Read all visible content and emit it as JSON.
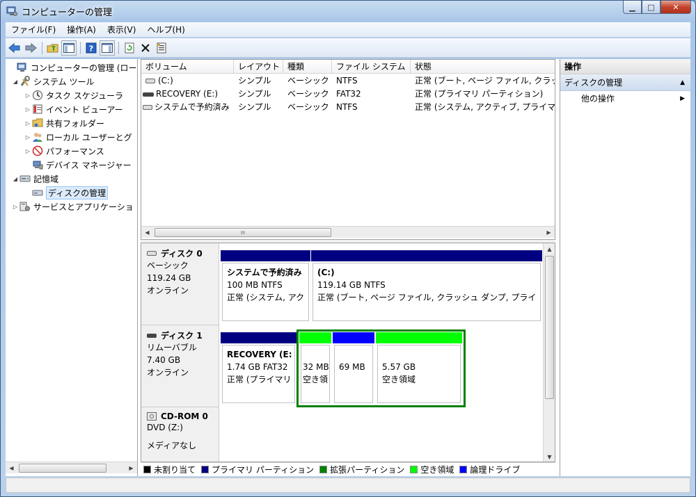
{
  "window": {
    "title": "コンピューターの管理",
    "controls": [
      "minimize",
      "maximize",
      "close"
    ]
  },
  "menubar": {
    "items": [
      "ファイル(F)",
      "操作(A)",
      "表示(V)",
      "ヘルプ(H)"
    ]
  },
  "toolbar": {
    "icons": [
      "back-icon",
      "forward-icon",
      "up-folder-icon",
      "show-hide-tree-icon",
      "help-icon",
      "show-hide-action-icon",
      "refresh-icon",
      "delete-icon",
      "properties-icon"
    ]
  },
  "tree": {
    "items": [
      {
        "label": "コンピューターの管理 (ローカ",
        "icon": "computer-management-icon",
        "arrow": ""
      },
      {
        "label": "システム ツール",
        "icon": "system-tools-icon",
        "arrow": "◢"
      },
      {
        "label": "タスク スケジューラ",
        "icon": "task-scheduler-icon",
        "arrow": "▷"
      },
      {
        "label": "イベント ビューアー",
        "icon": "event-viewer-icon",
        "arrow": "▷"
      },
      {
        "label": "共有フォルダー",
        "icon": "shared-folder-icon",
        "arrow": "▷"
      },
      {
        "label": "ローカル ユーザーとグ",
        "icon": "local-users-icon",
        "arrow": "▷"
      },
      {
        "label": "パフォーマンス",
        "icon": "performance-icon",
        "arrow": "▷"
      },
      {
        "label": "デバイス マネージャー",
        "icon": "device-manager-icon",
        "arrow": ""
      },
      {
        "label": "記憶域",
        "icon": "storage-icon",
        "arrow": "◢"
      },
      {
        "label": "ディスクの管理",
        "icon": "disk-management-icon",
        "arrow": ""
      },
      {
        "label": "サービスとアプリケーショ",
        "icon": "services-icon",
        "arrow": "▷"
      }
    ]
  },
  "volumes": {
    "headers": [
      "ボリューム",
      "レイアウト",
      "種類",
      "ファイル システム",
      "状態"
    ],
    "rows": [
      {
        "volume": "(C:)",
        "layout": "シンプル",
        "type": "ベーシック",
        "fs": "NTFS",
        "status": "正常 (ブート, ページ ファイル, クラッ"
      },
      {
        "volume": "RECOVERY (E:)",
        "layout": "シンプル",
        "type": "ベーシック",
        "fs": "FAT32",
        "status": "正常 (プライマリ パーティション)"
      },
      {
        "volume": "システムで予約済み",
        "layout": "シンプル",
        "type": "ベーシック",
        "fs": "NTFS",
        "status": "正常 (システム, アクティブ, プライマ"
      }
    ],
    "scroll_glyph": "III"
  },
  "disks": {
    "disk0": {
      "name": "ディスク 0",
      "type": "ベーシック",
      "size": "119.24 GB",
      "state": "オンライン",
      "partitions": [
        {
          "title": "システムで予約済み",
          "size": "100 MB NTFS",
          "status": "正常 (システム, アク"
        },
        {
          "title": "(C:)",
          "size": "119.14 GB NTFS",
          "status": "正常 (ブート, ページ ファイル, クラッシュ ダンプ, プライ"
        }
      ]
    },
    "disk1": {
      "name": "ディスク 1",
      "type": "リムーバブル",
      "size": "7.40 GB",
      "state": "オンライン",
      "partitions": [
        {
          "title": "RECOVERY (E:",
          "size": "1.74 GB FAT32",
          "status": "正常 (プライマリ"
        },
        {
          "size": "32 MB",
          "status": "空き領"
        },
        {
          "size": "69 MB",
          "status": ""
        },
        {
          "size": "5.57 GB",
          "status": "空き領域"
        }
      ]
    },
    "cdrom": {
      "name": "CD-ROM 0",
      "drive": "DVD (Z:)",
      "media": "メディアなし"
    }
  },
  "legend": [
    {
      "label": "未割り当て",
      "color": "#000000"
    },
    {
      "label": "プライマリ パーティション",
      "color": "#000080"
    },
    {
      "label": "拡張パーティション",
      "color": "#008000"
    },
    {
      "label": "空き領域",
      "color": "#00ff00"
    },
    {
      "label": "論理ドライブ",
      "color": "#0000ff"
    }
  ],
  "actions": {
    "header": "操作",
    "section": "ディスクの管理",
    "items": [
      "他の操作"
    ]
  },
  "colors": {
    "primary": "#000080",
    "free": "#00ff00",
    "logical": "#0000ff",
    "extended": "#008000"
  }
}
